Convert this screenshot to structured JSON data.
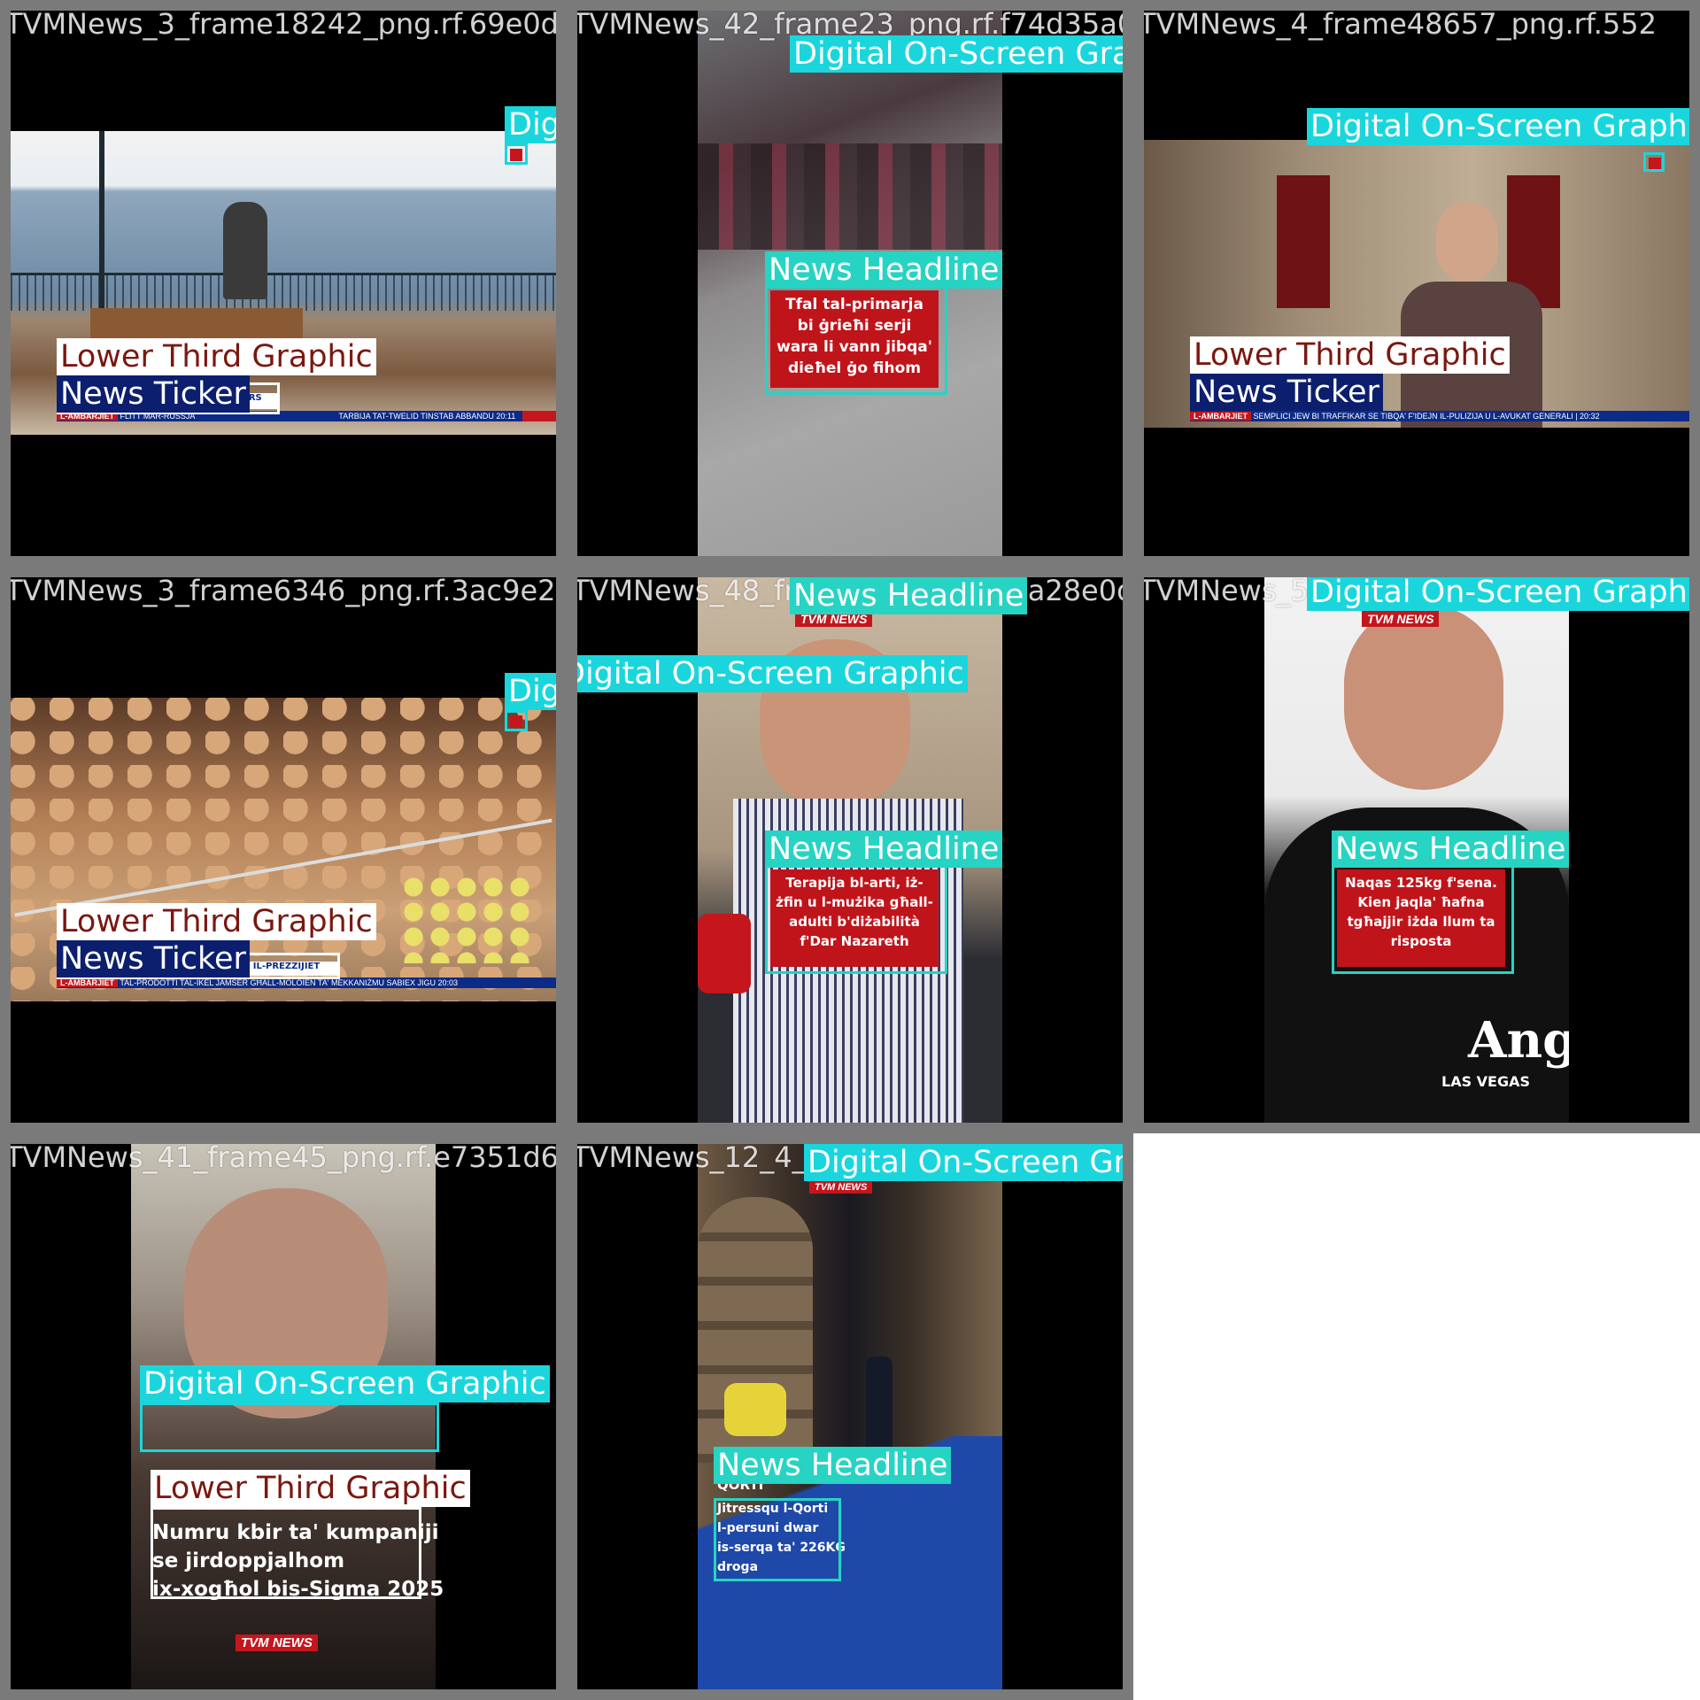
{
  "tiles": [
    {
      "filename": "TVMNews_3_frame18242_png.rf.69e0d7a0620",
      "labels": {
        "dosg": "Digital On-Screen Graphic",
        "ltg": "Lower Third Graphic",
        "nt": "News Ticker"
      },
      "ticker": {
        "tag": "L-AMBARJIET",
        "text": "FLITT MAR-RUSSJA",
        "text2": "TARBIJA TAT-TWELID TINSTAB ABBANDU 20:11"
      },
      "lower_third_suffix": "ERS"
    },
    {
      "filename": "TVMNews_42_frame23_png.rf.f74d35a0d4df",
      "labels": {
        "dosg": "Digital On-Screen Graphic",
        "nh": "News Headline"
      },
      "headline": "Tfal tal-primarja bi ġrieħi serji wara li vann jibqa' dieħel ġo fihom"
    },
    {
      "filename": "TVMNews_4_frame48657_png.rf.552",
      "labels": {
        "dosg": "Digital On-Screen Graphic",
        "ltg": "Lower Third Graphic",
        "nt": "News Ticker"
      },
      "ticker": {
        "tag": "L-AMBARJIET",
        "text": "SEMPLICI JEW BI TRAFFIKAR SE TIBQA' F'IDEJN IL-PULIZIJA U L-AVUKAT GENERALI | 20:32"
      }
    },
    {
      "filename": "TVMNews_3_frame6346_png.rf.3ac9e294b9a4",
      "labels": {
        "dosg": "Digital On-Screen Graphic",
        "ltg": "Lower Third Graphic",
        "nt": "News Ticker"
      },
      "ticker": {
        "tag": "L-AMBARJIET",
        "text": "TAL-PRODOTTI TAL-IKEL JAMSER GĦALL-MOLOIEN TA' MEKKANIŻMU SABIEX JIGU 20:03"
      },
      "lower_third_suffix": "D IL-PREZZIJIET"
    },
    {
      "filename": "TVMNews_48_frame_png.rf.df8da28e0deb0",
      "labels": {
        "nh_top": "News Headline",
        "dosg": "Digital On-Screen Graphic",
        "nh": "News Headline"
      },
      "logo": "TVM NEWS",
      "headline": "Terapija bl-arti, iż-żfin u l-mużika għall-adulti b'diżabilità f'Dar Nazareth"
    },
    {
      "filename": "TVMNews_5_frame_png.rf",
      "labels": {
        "dosg": "Digital On-Screen Graphic",
        "nh": "News Headline"
      },
      "logo": "TVM NEWS",
      "headline": "Naqas 125kg f'sena. Kien jaqla' ħafna tgħajjir iżda llum ta risposta",
      "shirt_text": "Ang",
      "shirt_sub": "LAS VEGAS"
    },
    {
      "filename": "TVMNews_41_frame45_png.rf.e7351d6390",
      "labels": {
        "dosg": "Digital On-Screen Graphic",
        "ltg": "Lower Third Graphic"
      },
      "caption": [
        "Numru kbir ta' kumpaniji",
        "se jirdoppjalhom",
        "ix-xogħol bis-Sigma 2025"
      ],
      "logo": "TVM NEWS"
    },
    {
      "filename": "TVMNews_12_4_frame_png.rf.abb49",
      "labels": {
        "dosg": "Digital On-Screen Graphic",
        "nh": "News Headline"
      },
      "logo": "TVM NEWS",
      "headline_title": "QORTI",
      "headline": [
        "Jitressqu l-Qorti",
        "l-persuni dwar",
        "is-serqa ta' 226KG",
        "droga"
      ]
    }
  ]
}
